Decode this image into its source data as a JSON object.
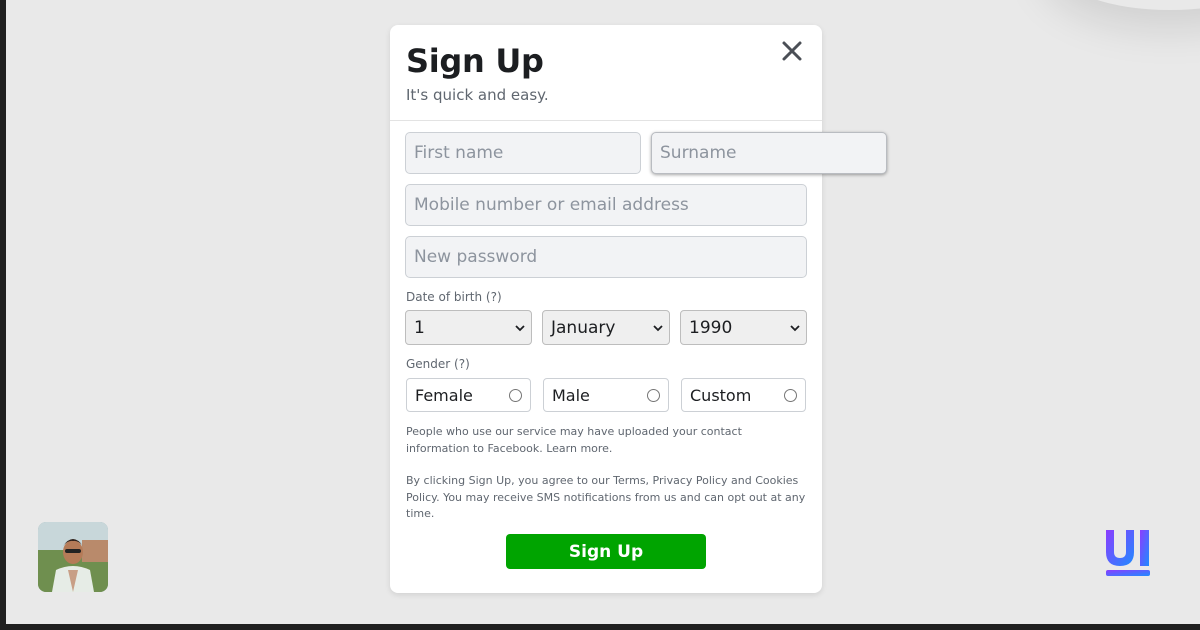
{
  "modal": {
    "title": "Sign Up",
    "subtitle": "It's quick and easy.",
    "close_icon": "close-icon"
  },
  "form": {
    "first_name_placeholder": "First name",
    "surname_placeholder": "Surname",
    "contact_placeholder": "Mobile number or email address",
    "password_placeholder": "New password",
    "dob_label": "Date of birth (?)",
    "dob_day": "1",
    "dob_month": "January",
    "dob_year": "1990",
    "gender_label": "Gender (?)",
    "gender_options": [
      "Female",
      "Male",
      "Custom"
    ],
    "notice_1": "People who use our service may have uploaded your contact information to Facebook. Learn more.",
    "notice_2": "By clicking Sign Up, you agree to our Terms, Privacy Policy and Cookies Policy. You may receive SMS notifications from us and can opt out at any time.",
    "submit_label": "Sign Up"
  },
  "colors": {
    "submit": "#00a400",
    "page_background": "#e9e9e9",
    "logo_gradient": [
      "#8b3dff",
      "#1f8bff"
    ]
  },
  "icons": {
    "select_chevron": "chevron-down-icon",
    "avatar": "user-photo",
    "brand": "ui-logo"
  }
}
